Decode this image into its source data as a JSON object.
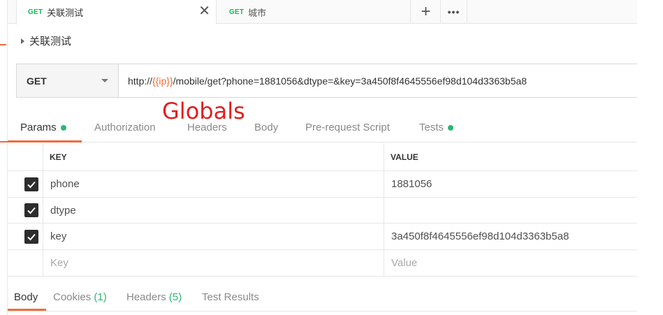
{
  "tabs": [
    {
      "method": "GET",
      "name": "关联测试",
      "close": "✕"
    },
    {
      "method": "GET",
      "name": "城市"
    }
  ],
  "tab_actions": {
    "new": "+",
    "more": "•••"
  },
  "request": {
    "name": "关联测试",
    "method": "GET",
    "url_prefix": "http://",
    "url_variable": "{{ip}}",
    "url_suffix": "/mobile/get?phone=1881056&dtype=&key=3a450f8f4645556ef98d104d3363b5a8"
  },
  "annotation": "Globals",
  "request_tabs": [
    {
      "label": "Params",
      "dot": true
    },
    {
      "label": "Authorization"
    },
    {
      "label": "Headers"
    },
    {
      "label": "Body"
    },
    {
      "label": "Pre-request Script"
    },
    {
      "label": "Tests",
      "dot": true
    }
  ],
  "params": {
    "headers": {
      "key": "KEY",
      "value": "VALUE"
    },
    "rows": [
      {
        "checked": true,
        "key": "phone",
        "value": "1881056"
      },
      {
        "checked": true,
        "key": "dtype",
        "value": ""
      },
      {
        "checked": true,
        "key": "key",
        "value": "3a450f8f4645556ef98d104d3363b5a8"
      }
    ],
    "placeholder": {
      "key": "Key",
      "value": "Value"
    }
  },
  "response_tabs": [
    {
      "label": "Body"
    },
    {
      "label": "Cookies",
      "count": "(1)"
    },
    {
      "label": "Headers",
      "count": "(5)"
    },
    {
      "label": "Test Results"
    }
  ],
  "colors": {
    "accent": "#f26b3a",
    "green": "#2bb673",
    "method_green": "#0cbb52",
    "annotation_red": "#e02020"
  }
}
